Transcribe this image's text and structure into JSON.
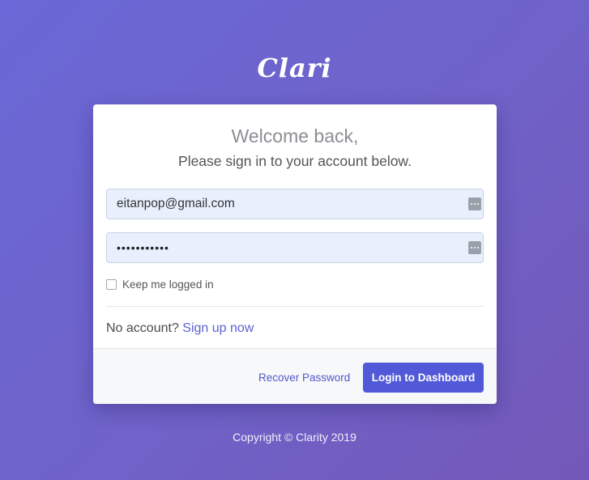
{
  "brand": {
    "logo_text": "Clari"
  },
  "login": {
    "welcome": "Welcome back,",
    "subtitle": "Please sign in to your account below.",
    "email_value": "eitanpop@gmail.com",
    "password_masked": "•••••••••••",
    "remember_label": "Keep me logged in",
    "remember_checked": false,
    "no_account_text": "No account?",
    "signup_link": "Sign up now",
    "recover_link": "Recover Password",
    "submit_label": "Login to Dashboard"
  },
  "footer": {
    "copyright": "Copyright © Clarity 2019"
  },
  "colors": {
    "background_start": "#6a68d6",
    "background_end": "#7358b8",
    "accent": "#5159d9",
    "link": "#5b62d6",
    "input_bg": "#e8f0fe"
  },
  "icons": {
    "field_helper": "password-manager-icon"
  }
}
